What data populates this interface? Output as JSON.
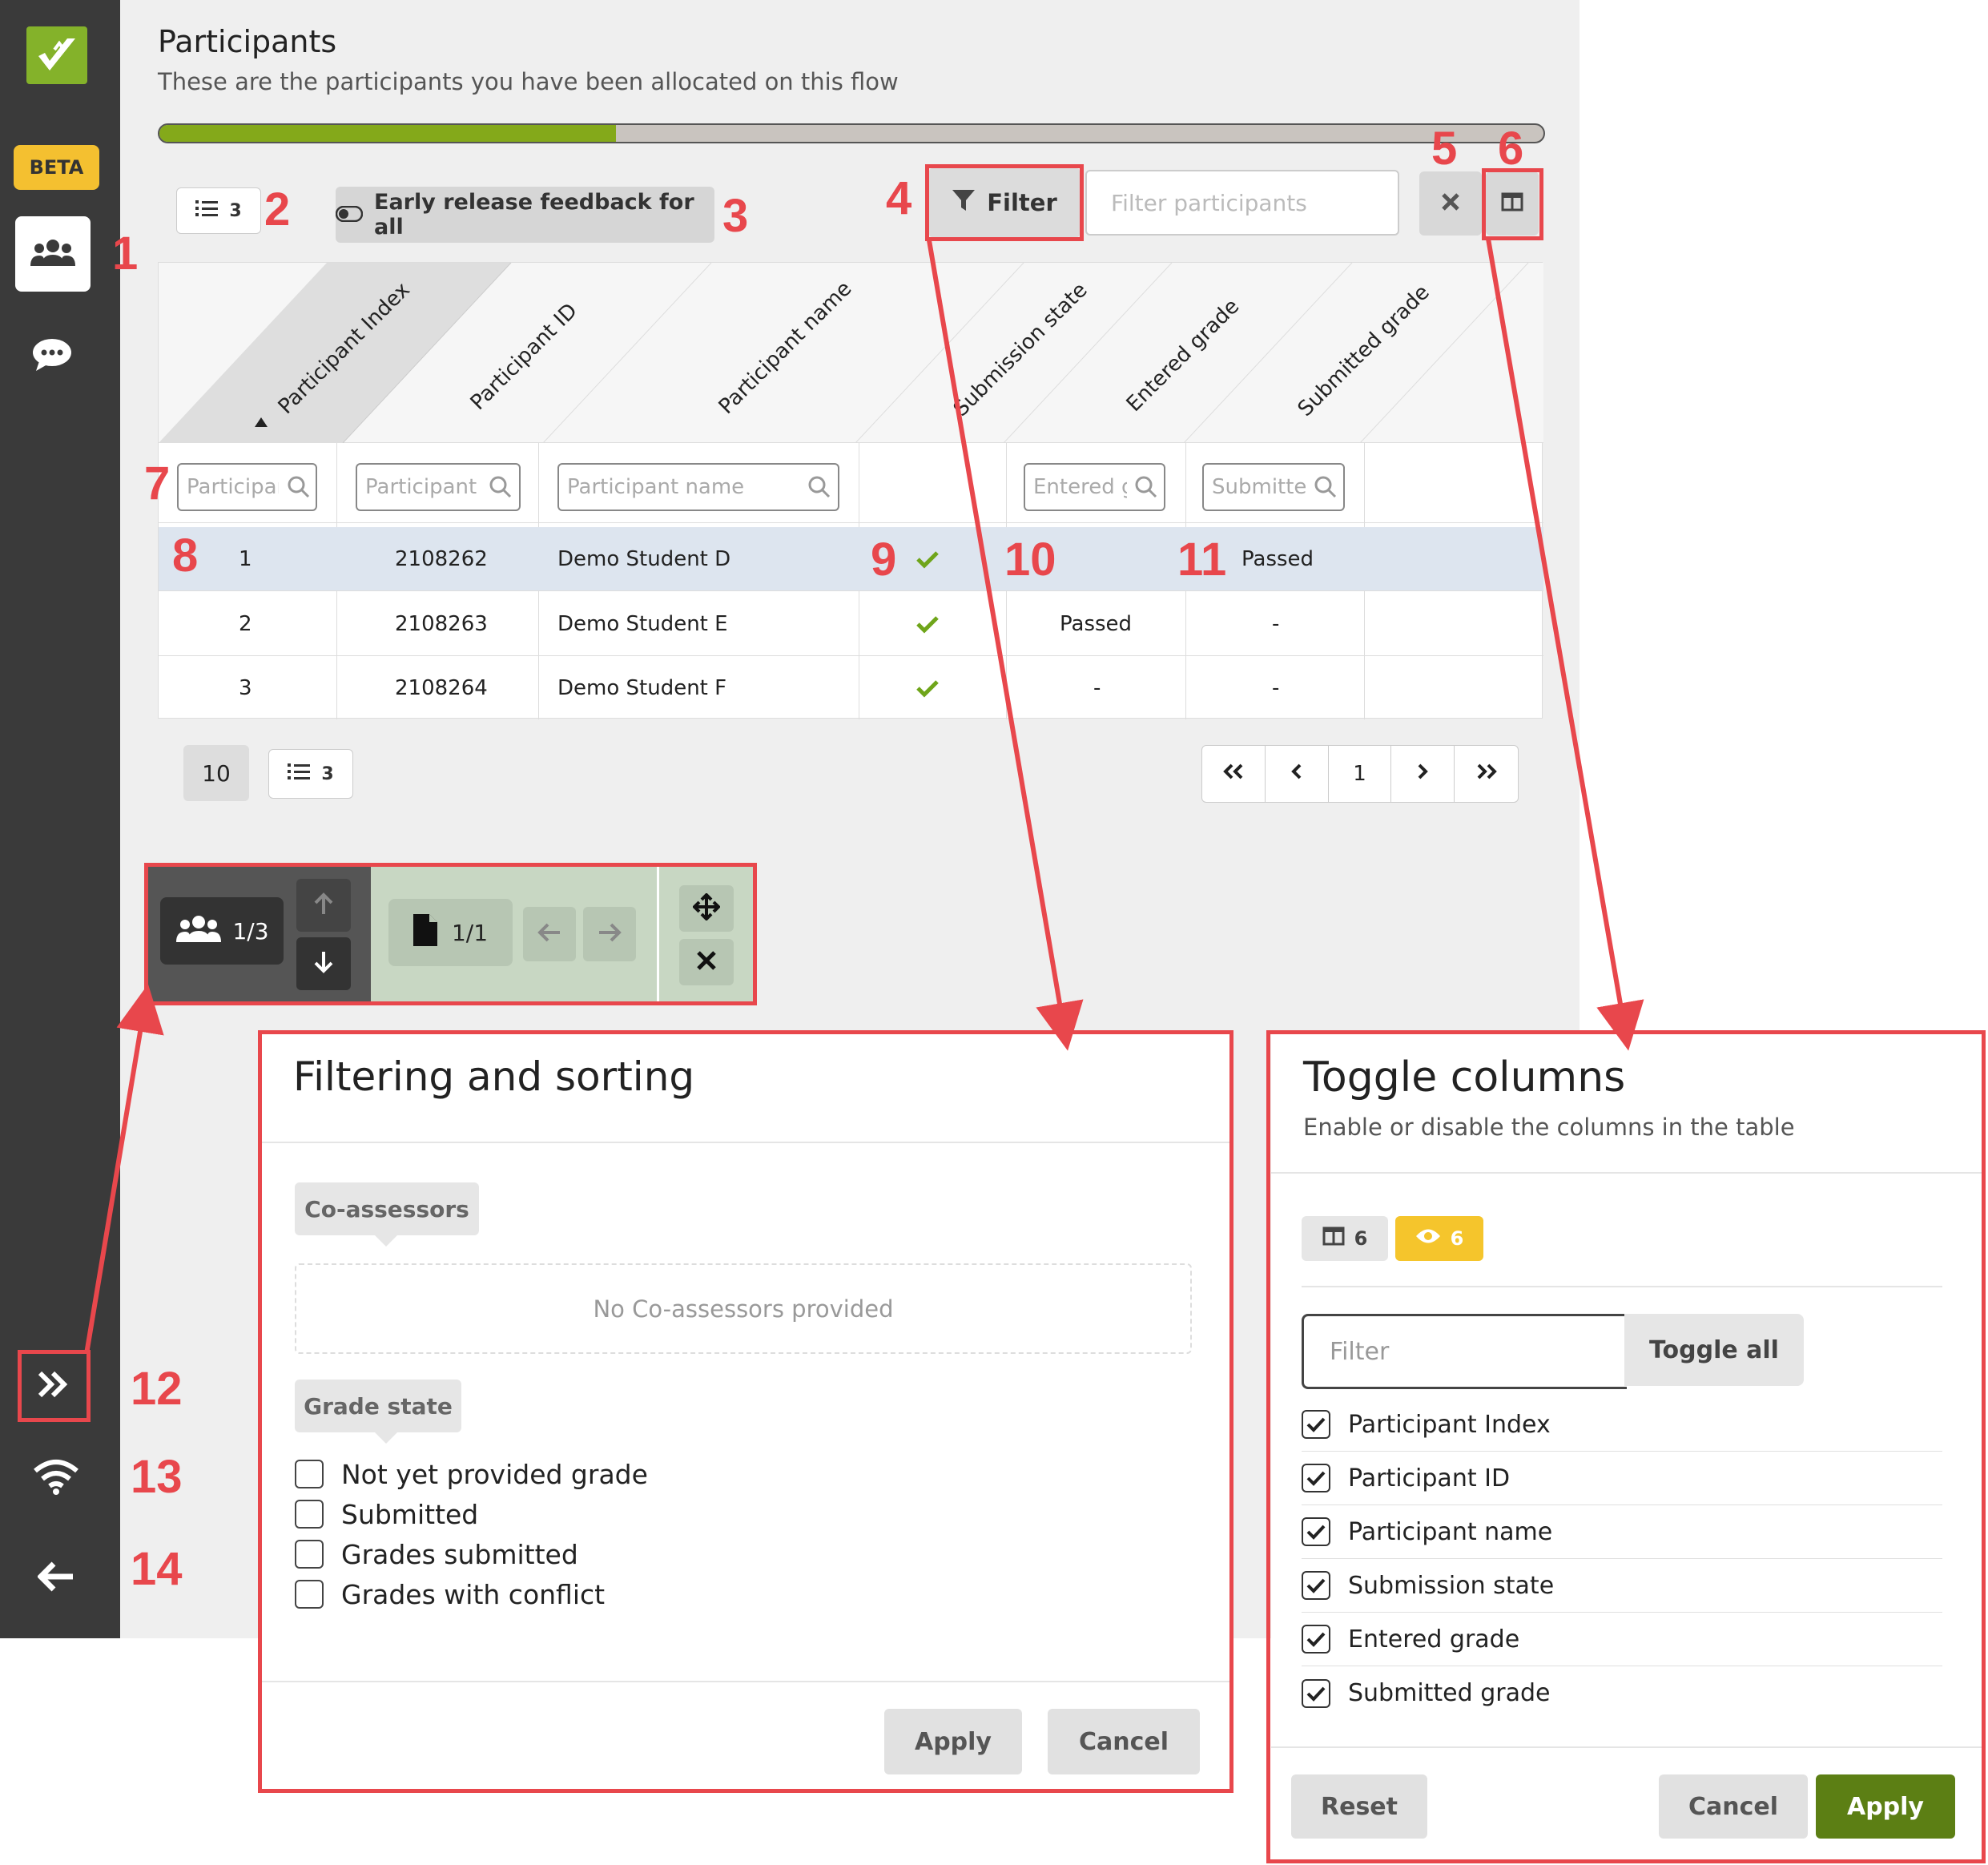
{
  "sidebar": {
    "beta_label": "BETA"
  },
  "header": {
    "title": "Participants",
    "subtitle": "These are the participants you have been allocated on this flow",
    "progress_fraction": 0.33
  },
  "toolbar": {
    "count_value": "3",
    "early_release_label": "Early release feedback for all",
    "filter_label": "Filter",
    "filter_placeholder": "Filter participants"
  },
  "table": {
    "columns": [
      "Participant Index",
      "Participant ID",
      "Participant name",
      "Submission state",
      "Entered grade",
      "Submitted grade"
    ],
    "column_filters": [
      "Participant Index",
      "Participant ID",
      "Participant name",
      "",
      "Entered grade",
      "Submitted grade"
    ],
    "rows": [
      {
        "index": "1",
        "id": "2108262",
        "name": "Demo Student D",
        "entered": "",
        "submitted": "Passed"
      },
      {
        "index": "2",
        "id": "2108263",
        "name": "Demo Student E",
        "entered": "Passed",
        "submitted": "-"
      },
      {
        "index": "3",
        "id": "2108264",
        "name": "Demo Student F",
        "entered": "-",
        "submitted": "-"
      }
    ]
  },
  "pagination": {
    "page_size": "10",
    "count_value": "3",
    "current_page": "1"
  },
  "floating_nav": {
    "participant_position": "1/3",
    "document_position": "1/1"
  },
  "annotations": [
    "1",
    "2",
    "3",
    "4",
    "5",
    "6",
    "7",
    "8",
    "9",
    "10",
    "11",
    "12",
    "13",
    "14"
  ],
  "filter_dialog": {
    "title": "Filtering and sorting",
    "coassessors_label": "Co-assessors",
    "coassessors_empty": "No Co-assessors provided",
    "grade_state_label": "Grade state",
    "grade_options": [
      "Not yet provided grade",
      "Submitted",
      "Grades submitted",
      "Grades with conflict"
    ],
    "apply_label": "Apply",
    "cancel_label": "Cancel"
  },
  "toggle_dialog": {
    "title": "Toggle columns",
    "subtitle": "Enable or disable the columns in the table",
    "column_count": "6",
    "visible_count": "6",
    "filter_placeholder": "Filter",
    "toggle_all_label": "Toggle all",
    "columns": [
      "Participant Index",
      "Participant ID",
      "Participant name",
      "Submission state",
      "Entered grade",
      "Submitted grade"
    ],
    "reset_label": "Reset",
    "cancel_label": "Cancel",
    "apply_label": "Apply"
  },
  "colors": {
    "accent_green": "#84a91a",
    "annotation_red": "#e8474c",
    "beta_yellow": "#f4c030",
    "apply_green": "#5c7f14"
  }
}
